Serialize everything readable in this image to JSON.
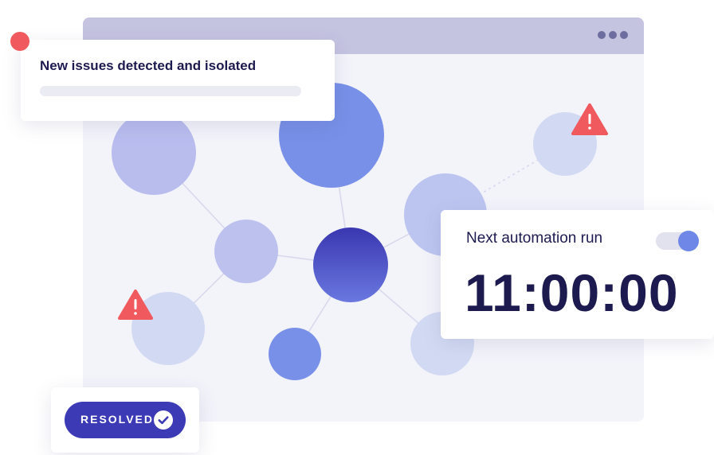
{
  "issues_card": {
    "title": "New issues detected and isolated"
  },
  "automation_card": {
    "title": "Next automation run",
    "toggle_on": true,
    "time": "11:00:00"
  },
  "resolved_badge": {
    "label": "RESOLVED"
  },
  "icons": {
    "window_menu": "more-horizontal-icon",
    "alert": "warning-triangle-icon",
    "check": "check-circle-icon"
  },
  "colors": {
    "window_bg": "#f3f3fa",
    "titlebar": "#c4c3e0",
    "text_dark": "#1d1a4f",
    "accent": "#3d3ab5",
    "node_blue": "#7890e8",
    "alert_red": "#f05a5e"
  }
}
